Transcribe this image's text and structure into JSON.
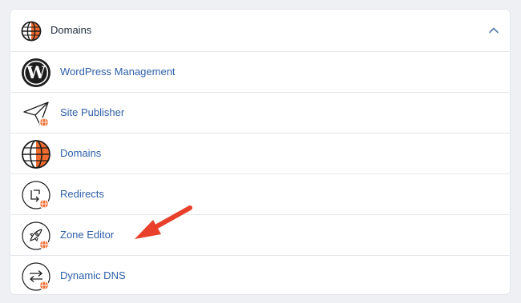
{
  "header": {
    "title": "Domains"
  },
  "items": [
    {
      "label": "WordPress Management",
      "icon": "wordpress-icon"
    },
    {
      "label": "Site Publisher",
      "icon": "paper-plane-icon"
    },
    {
      "label": "Domains",
      "icon": "globe-icon"
    },
    {
      "label": "Redirects",
      "icon": "redirect-icon"
    },
    {
      "label": "Zone Editor",
      "icon": "rocket-icon"
    },
    {
      "label": "Dynamic DNS",
      "icon": "swap-arrows-icon"
    }
  ],
  "colors": {
    "accent": "#ef6a2e",
    "link": "#2d5fa8",
    "annotation_arrow": "#e8402a"
  }
}
